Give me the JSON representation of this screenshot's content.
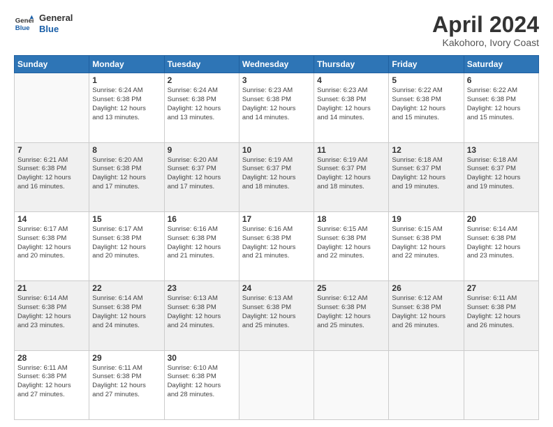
{
  "header": {
    "logo_line1": "General",
    "logo_line2": "Blue",
    "title": "April 2024",
    "subtitle": "Kakohoro, Ivory Coast"
  },
  "calendar": {
    "days_of_week": [
      "Sunday",
      "Monday",
      "Tuesday",
      "Wednesday",
      "Thursday",
      "Friday",
      "Saturday"
    ],
    "weeks": [
      [
        {
          "day": "",
          "info": ""
        },
        {
          "day": "1",
          "info": "Sunrise: 6:24 AM\nSunset: 6:38 PM\nDaylight: 12 hours\nand 13 minutes."
        },
        {
          "day": "2",
          "info": "Sunrise: 6:24 AM\nSunset: 6:38 PM\nDaylight: 12 hours\nand 13 minutes."
        },
        {
          "day": "3",
          "info": "Sunrise: 6:23 AM\nSunset: 6:38 PM\nDaylight: 12 hours\nand 14 minutes."
        },
        {
          "day": "4",
          "info": "Sunrise: 6:23 AM\nSunset: 6:38 PM\nDaylight: 12 hours\nand 14 minutes."
        },
        {
          "day": "5",
          "info": "Sunrise: 6:22 AM\nSunset: 6:38 PM\nDaylight: 12 hours\nand 15 minutes."
        },
        {
          "day": "6",
          "info": "Sunrise: 6:22 AM\nSunset: 6:38 PM\nDaylight: 12 hours\nand 15 minutes."
        }
      ],
      [
        {
          "day": "7",
          "info": "Sunrise: 6:21 AM\nSunset: 6:38 PM\nDaylight: 12 hours\nand 16 minutes."
        },
        {
          "day": "8",
          "info": "Sunrise: 6:20 AM\nSunset: 6:38 PM\nDaylight: 12 hours\nand 17 minutes."
        },
        {
          "day": "9",
          "info": "Sunrise: 6:20 AM\nSunset: 6:37 PM\nDaylight: 12 hours\nand 17 minutes."
        },
        {
          "day": "10",
          "info": "Sunrise: 6:19 AM\nSunset: 6:37 PM\nDaylight: 12 hours\nand 18 minutes."
        },
        {
          "day": "11",
          "info": "Sunrise: 6:19 AM\nSunset: 6:37 PM\nDaylight: 12 hours\nand 18 minutes."
        },
        {
          "day": "12",
          "info": "Sunrise: 6:18 AM\nSunset: 6:37 PM\nDaylight: 12 hours\nand 19 minutes."
        },
        {
          "day": "13",
          "info": "Sunrise: 6:18 AM\nSunset: 6:37 PM\nDaylight: 12 hours\nand 19 minutes."
        }
      ],
      [
        {
          "day": "14",
          "info": "Sunrise: 6:17 AM\nSunset: 6:38 PM\nDaylight: 12 hours\nand 20 minutes."
        },
        {
          "day": "15",
          "info": "Sunrise: 6:17 AM\nSunset: 6:38 PM\nDaylight: 12 hours\nand 20 minutes."
        },
        {
          "day": "16",
          "info": "Sunrise: 6:16 AM\nSunset: 6:38 PM\nDaylight: 12 hours\nand 21 minutes."
        },
        {
          "day": "17",
          "info": "Sunrise: 6:16 AM\nSunset: 6:38 PM\nDaylight: 12 hours\nand 21 minutes."
        },
        {
          "day": "18",
          "info": "Sunrise: 6:15 AM\nSunset: 6:38 PM\nDaylight: 12 hours\nand 22 minutes."
        },
        {
          "day": "19",
          "info": "Sunrise: 6:15 AM\nSunset: 6:38 PM\nDaylight: 12 hours\nand 22 minutes."
        },
        {
          "day": "20",
          "info": "Sunrise: 6:14 AM\nSunset: 6:38 PM\nDaylight: 12 hours\nand 23 minutes."
        }
      ],
      [
        {
          "day": "21",
          "info": "Sunrise: 6:14 AM\nSunset: 6:38 PM\nDaylight: 12 hours\nand 23 minutes."
        },
        {
          "day": "22",
          "info": "Sunrise: 6:14 AM\nSunset: 6:38 PM\nDaylight: 12 hours\nand 24 minutes."
        },
        {
          "day": "23",
          "info": "Sunrise: 6:13 AM\nSunset: 6:38 PM\nDaylight: 12 hours\nand 24 minutes."
        },
        {
          "day": "24",
          "info": "Sunrise: 6:13 AM\nSunset: 6:38 PM\nDaylight: 12 hours\nand 25 minutes."
        },
        {
          "day": "25",
          "info": "Sunrise: 6:12 AM\nSunset: 6:38 PM\nDaylight: 12 hours\nand 25 minutes."
        },
        {
          "day": "26",
          "info": "Sunrise: 6:12 AM\nSunset: 6:38 PM\nDaylight: 12 hours\nand 26 minutes."
        },
        {
          "day": "27",
          "info": "Sunrise: 6:11 AM\nSunset: 6:38 PM\nDaylight: 12 hours\nand 26 minutes."
        }
      ],
      [
        {
          "day": "28",
          "info": "Sunrise: 6:11 AM\nSunset: 6:38 PM\nDaylight: 12 hours\nand 27 minutes."
        },
        {
          "day": "29",
          "info": "Sunrise: 6:11 AM\nSunset: 6:38 PM\nDaylight: 12 hours\nand 27 minutes."
        },
        {
          "day": "30",
          "info": "Sunrise: 6:10 AM\nSunset: 6:38 PM\nDaylight: 12 hours\nand 28 minutes."
        },
        {
          "day": "",
          "info": ""
        },
        {
          "day": "",
          "info": ""
        },
        {
          "day": "",
          "info": ""
        },
        {
          "day": "",
          "info": ""
        }
      ]
    ]
  }
}
